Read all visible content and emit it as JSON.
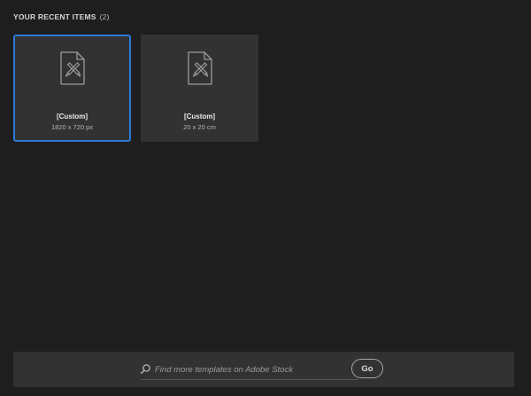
{
  "recent": {
    "heading": "YOUR RECENT ITEMS",
    "count": "(2)",
    "items": [
      {
        "title": "[Custom]",
        "size": "1820 x 720 px",
        "selected": true
      },
      {
        "title": "[Custom]",
        "size": "20 x 20 cm",
        "selected": false
      }
    ]
  },
  "stock": {
    "search_placeholder": "Find more templates on Adobe Stock",
    "search_value": "",
    "go_label": "Go"
  },
  "icons": {
    "document": "document-pen-icon",
    "search": "search-icon"
  },
  "colors": {
    "background": "#1e1e1e",
    "tile": "#323232",
    "selection": "#2d7ad6",
    "text": "#e8e8e8"
  }
}
